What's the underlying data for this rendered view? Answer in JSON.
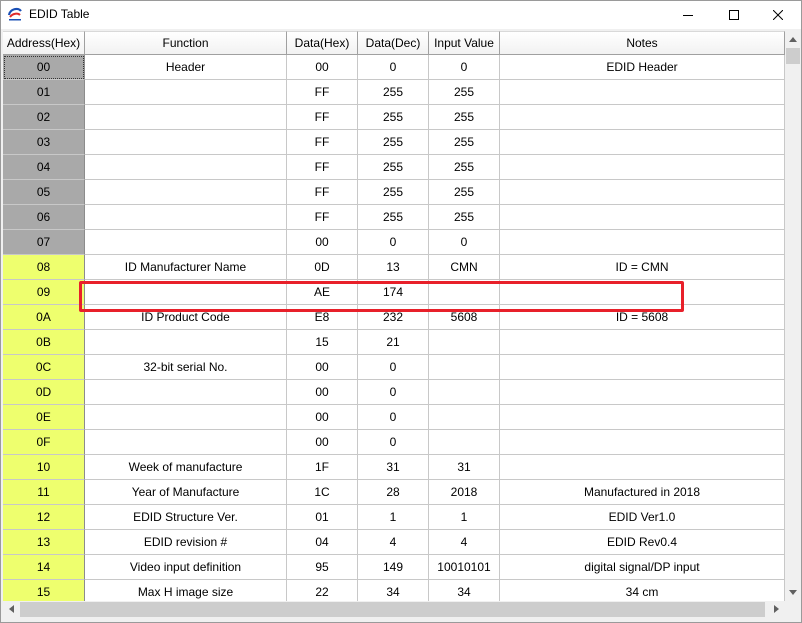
{
  "window": {
    "title": "EDID Table"
  },
  "colors": {
    "gray_address": "#a9a9a9",
    "yellow_address": "#eeff6e",
    "highlight": "#e8202a"
  },
  "table": {
    "columns": [
      "Address(Hex)",
      "Function",
      "Data(Hex)",
      "Data(Dec)",
      "Input Value",
      "Notes"
    ],
    "rows": [
      {
        "address": "00",
        "function": "Header",
        "hex": "00",
        "dec": "0",
        "input": "0",
        "notes": "EDID Header",
        "shade": "gray"
      },
      {
        "address": "01",
        "function": "",
        "hex": "FF",
        "dec": "255",
        "input": "255",
        "notes": "",
        "shade": "gray"
      },
      {
        "address": "02",
        "function": "",
        "hex": "FF",
        "dec": "255",
        "input": "255",
        "notes": "",
        "shade": "gray"
      },
      {
        "address": "03",
        "function": "",
        "hex": "FF",
        "dec": "255",
        "input": "255",
        "notes": "",
        "shade": "gray"
      },
      {
        "address": "04",
        "function": "",
        "hex": "FF",
        "dec": "255",
        "input": "255",
        "notes": "",
        "shade": "gray"
      },
      {
        "address": "05",
        "function": "",
        "hex": "FF",
        "dec": "255",
        "input": "255",
        "notes": "",
        "shade": "gray"
      },
      {
        "address": "06",
        "function": "",
        "hex": "FF",
        "dec": "255",
        "input": "255",
        "notes": "",
        "shade": "gray"
      },
      {
        "address": "07",
        "function": "",
        "hex": "00",
        "dec": "0",
        "input": "0",
        "notes": "",
        "shade": "gray"
      },
      {
        "address": "08",
        "function": "ID Manufacturer Name",
        "hex": "0D",
        "dec": "13",
        "input": "CMN",
        "notes": "ID = CMN",
        "shade": "yellow"
      },
      {
        "address": "09",
        "function": "",
        "hex": "AE",
        "dec": "174",
        "input": "",
        "notes": "",
        "shade": "yellow"
      },
      {
        "address": "0A",
        "function": "ID Product Code",
        "hex": "E8",
        "dec": "232",
        "input": "5608",
        "notes": "ID = 5608",
        "shade": "yellow"
      },
      {
        "address": "0B",
        "function": "",
        "hex": "15",
        "dec": "21",
        "input": "",
        "notes": "",
        "shade": "yellow"
      },
      {
        "address": "0C",
        "function": "32-bit serial No.",
        "hex": "00",
        "dec": "0",
        "input": "",
        "notes": "",
        "shade": "yellow"
      },
      {
        "address": "0D",
        "function": "",
        "hex": "00",
        "dec": "0",
        "input": "",
        "notes": "",
        "shade": "yellow"
      },
      {
        "address": "0E",
        "function": "",
        "hex": "00",
        "dec": "0",
        "input": "",
        "notes": "",
        "shade": "yellow"
      },
      {
        "address": "0F",
        "function": "",
        "hex": "00",
        "dec": "0",
        "input": "",
        "notes": "",
        "shade": "yellow"
      },
      {
        "address": "10",
        "function": "Week of manufacture",
        "hex": "1F",
        "dec": "31",
        "input": "31",
        "notes": "",
        "shade": "yellow"
      },
      {
        "address": "11",
        "function": "Year of Manufacture",
        "hex": "1C",
        "dec": "28",
        "input": "2018",
        "notes": "Manufactured in 2018",
        "shade": "yellow"
      },
      {
        "address": "12",
        "function": "EDID Structure Ver.",
        "hex": "01",
        "dec": "1",
        "input": "1",
        "notes": "EDID Ver1.0",
        "shade": "yellow"
      },
      {
        "address": "13",
        "function": "EDID revision #",
        "hex": "04",
        "dec": "4",
        "input": "4",
        "notes": "EDID Rev0.4",
        "shade": "yellow"
      },
      {
        "address": "14",
        "function": "Video input definition",
        "hex": "95",
        "dec": "149",
        "input": "10010101",
        "notes": "digital signal/DP input",
        "shade": "yellow"
      },
      {
        "address": "15",
        "function": "Max H image size",
        "hex": "22",
        "dec": "34",
        "input": "34",
        "notes": "34 cm",
        "shade": "yellow"
      }
    ]
  }
}
